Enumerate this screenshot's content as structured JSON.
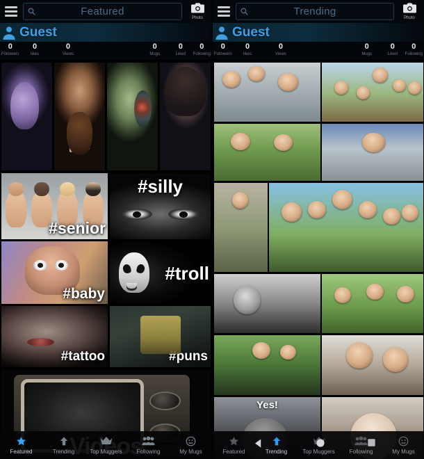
{
  "app": {
    "accent": "#3aa0e8",
    "nav_label_color": "#9aa0a6"
  },
  "panels": [
    {
      "id": "featured",
      "header": {
        "menu_icon": "hamburger-menu-icon",
        "search": {
          "icon": "search-icon",
          "value": "",
          "placeholder": "Featured"
        },
        "photo_button": {
          "icon": "camera-icon",
          "label": "Photo"
        }
      },
      "profile": {
        "avatar_icon": "person-avatar-icon",
        "name": "Guest",
        "stats": [
          {
            "value": "0",
            "label": "Followers"
          },
          {
            "value": "0",
            "label": "likes"
          },
          {
            "value": "0",
            "label": "Views"
          },
          {
            "value": "0",
            "label": "Mugs"
          },
          {
            "value": "0",
            "label": "Liked"
          },
          {
            "value": "0",
            "label": "Following"
          }
        ]
      },
      "tiles": [
        {
          "name": "tile-portrait-purple-villain",
          "caption": ""
        },
        {
          "name": "tile-portrait-bearded-man",
          "caption": ""
        },
        {
          "name": "tile-portrait-cyborg",
          "caption": ""
        },
        {
          "name": "tile-portrait-dark-haired-girl",
          "caption": ""
        },
        {
          "name": "tile-hashtag-senior",
          "caption": "#senior"
        },
        {
          "name": "tile-hashtag-silly",
          "caption": "#silly"
        },
        {
          "name": "tile-hashtag-baby",
          "caption": "#baby"
        },
        {
          "name": "tile-hashtag-troll",
          "caption": "#troll"
        },
        {
          "name": "tile-hashtag-tattoo",
          "caption": "#tattoo"
        },
        {
          "name": "tile-hashtag-puns",
          "caption": "#puns"
        },
        {
          "name": "tile-videos",
          "caption": "Videos"
        }
      ],
      "bottom_nav": {
        "active": "Featured",
        "items": [
          {
            "label": "Featured",
            "icon": "star-icon"
          },
          {
            "label": "Trending",
            "icon": "arrow-up-icon"
          },
          {
            "label": "Top Muggers",
            "icon": "crown-icon"
          },
          {
            "label": "Following",
            "icon": "people-icon"
          },
          {
            "label": "My Mugs",
            "icon": "face-icon"
          }
        ]
      },
      "system_nav": {
        "visible": false,
        "buttons": []
      }
    },
    {
      "id": "trending",
      "header": {
        "menu_icon": "hamburger-menu-icon",
        "search": {
          "icon": "search-icon",
          "value": "",
          "placeholder": "Trending"
        },
        "photo_button": {
          "icon": "camera-icon",
          "label": "Photo"
        }
      },
      "profile": {
        "avatar_icon": "person-avatar-icon",
        "name": "Guest",
        "stats": [
          {
            "value": "0",
            "label": "Followers"
          },
          {
            "value": "0",
            "label": "likes"
          },
          {
            "value": "0",
            "label": "Views"
          },
          {
            "value": "0",
            "label": "Mugs"
          },
          {
            "value": "0",
            "label": "Liked"
          },
          {
            "value": "0",
            "label": "Following"
          }
        ]
      },
      "tiles": [
        {
          "name": "mug-tile-three-men-indoors",
          "caption": ""
        },
        {
          "name": "mug-tile-group-with-trophy",
          "caption": ""
        },
        {
          "name": "mug-tile-two-with-harmonium",
          "caption": ""
        },
        {
          "name": "mug-tile-man-in-orange-mountains",
          "caption": ""
        },
        {
          "name": "mug-tile-woman-by-wall",
          "caption": ""
        },
        {
          "name": "mug-tile-group-with-jeep",
          "caption": ""
        },
        {
          "name": "mug-tile-boy-black-and-white",
          "caption": ""
        },
        {
          "name": "mug-tile-three-men-field",
          "caption": ""
        },
        {
          "name": "mug-tile-couple-with-cow",
          "caption": ""
        },
        {
          "name": "mug-tile-man-and-woman-portrait",
          "caption": ""
        },
        {
          "name": "mug-tile-man-yes-caption",
          "caption": "Yes!"
        },
        {
          "name": "mug-tile-elderly-man",
          "caption": ""
        }
      ],
      "bottom_nav": {
        "active": "Trending",
        "items": [
          {
            "label": "Featured",
            "icon": "star-icon"
          },
          {
            "label": "Trending",
            "icon": "arrow-up-icon"
          },
          {
            "label": "Top Muggers",
            "icon": "crown-icon"
          },
          {
            "label": "Following",
            "icon": "people-icon"
          },
          {
            "label": "My Mugs",
            "icon": "face-icon"
          }
        ]
      },
      "system_nav": {
        "visible": true,
        "buttons": [
          {
            "name": "system-back-button",
            "icon": "triangle-back-icon"
          },
          {
            "name": "system-home-button",
            "icon": "circle-home-icon"
          },
          {
            "name": "system-recents-button",
            "icon": "square-recents-icon"
          }
        ]
      }
    }
  ]
}
